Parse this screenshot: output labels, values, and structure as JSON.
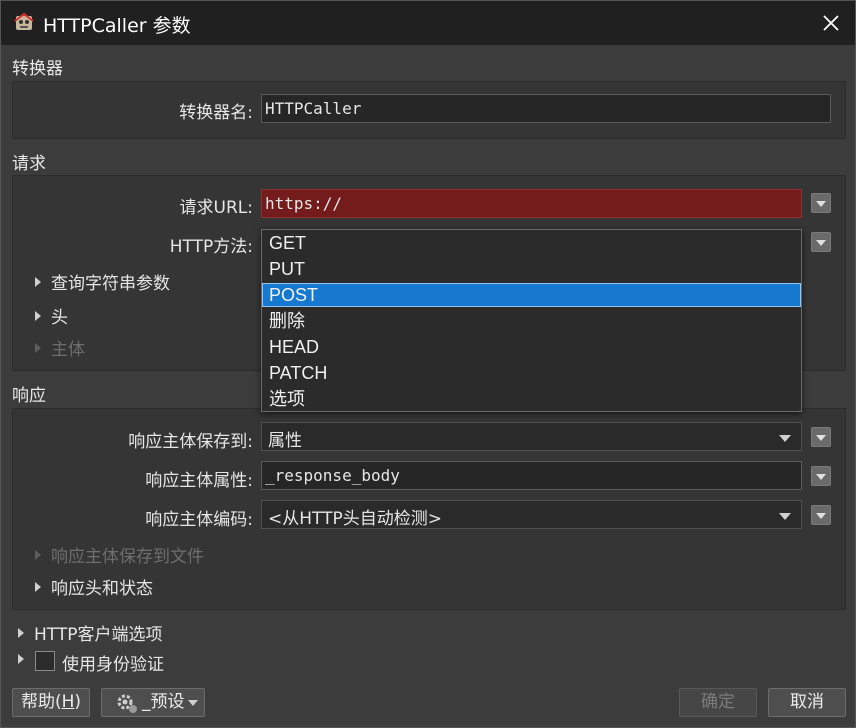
{
  "window": {
    "title": "HTTPCaller 参数"
  },
  "transformer": {
    "section_label": "转换器",
    "name_label": "转换器名:",
    "name_value": "HTTPCaller"
  },
  "request": {
    "section_label": "请求",
    "url_label": "请求URL:",
    "url_value": "https://",
    "method_label": "HTTP方法:",
    "method_options": [
      "GET",
      "PUT",
      "POST",
      "删除",
      "HEAD",
      "PATCH",
      "选项"
    ],
    "selected_method": "POST",
    "query_params": "查询字符串参数",
    "headers": "头",
    "body": "主体"
  },
  "response": {
    "section_label": "响应",
    "save_to_label": "响应主体保存到:",
    "save_to_value": "属性",
    "attr_label": "响应主体属性:",
    "attr_value": "_response_body",
    "encoding_label": "响应主体编码:",
    "encoding_value": "<从HTTP头自动检测>",
    "save_to_file": "响应主体保存到文件",
    "headers_status": "响应头和状态"
  },
  "client_options": "HTTP客户端选项",
  "auth": {
    "label": "使用身份验证",
    "checked": false
  },
  "footer": {
    "help_prefix": "帮助(",
    "help_key": "H",
    "help_suffix": ")",
    "presets": "_预设",
    "ok": "确定",
    "cancel": "取消"
  },
  "colors": {
    "selection": "#1679cf",
    "error_field": "#741b1b",
    "background": "#3c3c3c",
    "titlebar": "#202020"
  },
  "icons": [
    "app-icon",
    "close-icon",
    "chevron-down-icon",
    "expand-triangle-icon",
    "gear-icon"
  ]
}
